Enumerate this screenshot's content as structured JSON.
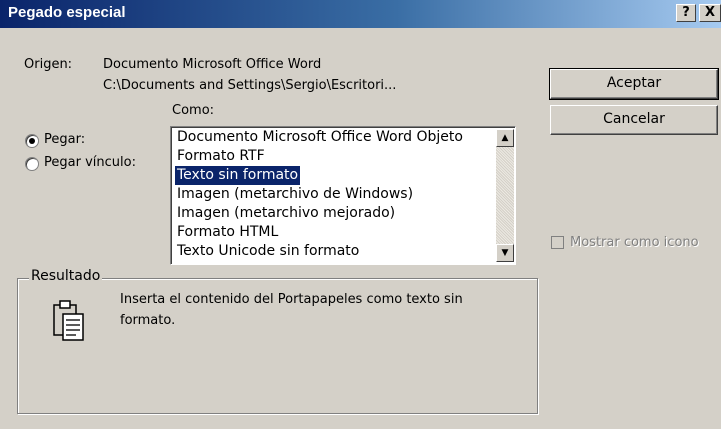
{
  "dialog": {
    "title": "Pegado especial",
    "help_btn": "?",
    "close_btn": "X"
  },
  "origin": {
    "label": "Origen:",
    "line1": "Documento Microsoft Office Word",
    "line2": "C:\\Documents and Settings\\Sergio\\Escritori..."
  },
  "como_label": "Como:",
  "radios": [
    {
      "label": "Pegar:",
      "selected": true
    },
    {
      "label": "Pegar vínculo:",
      "selected": false
    }
  ],
  "formats": [
    "Documento Microsoft Office Word Objeto",
    "Formato RTF",
    "Texto sin formato",
    "Imagen (metarchivo de Windows)",
    "Imagen (metarchivo mejorado)",
    "Formato HTML",
    "Texto Unicode sin formato"
  ],
  "selected_format": "Texto sin formato",
  "buttons": {
    "ok": "Aceptar",
    "cancel": "Cancelar"
  },
  "show_icon": {
    "label": "Mostrar como icono",
    "checked": false,
    "enabled": false
  },
  "result": {
    "legend": "Resultado",
    "text_line1": "Inserta el contenido del Portapapeles como texto sin",
    "text_line2": "formato."
  },
  "icons": [
    "help-icon",
    "close-icon",
    "scroll-up-icon",
    "scroll-down-icon",
    "clipboard-icon"
  ]
}
